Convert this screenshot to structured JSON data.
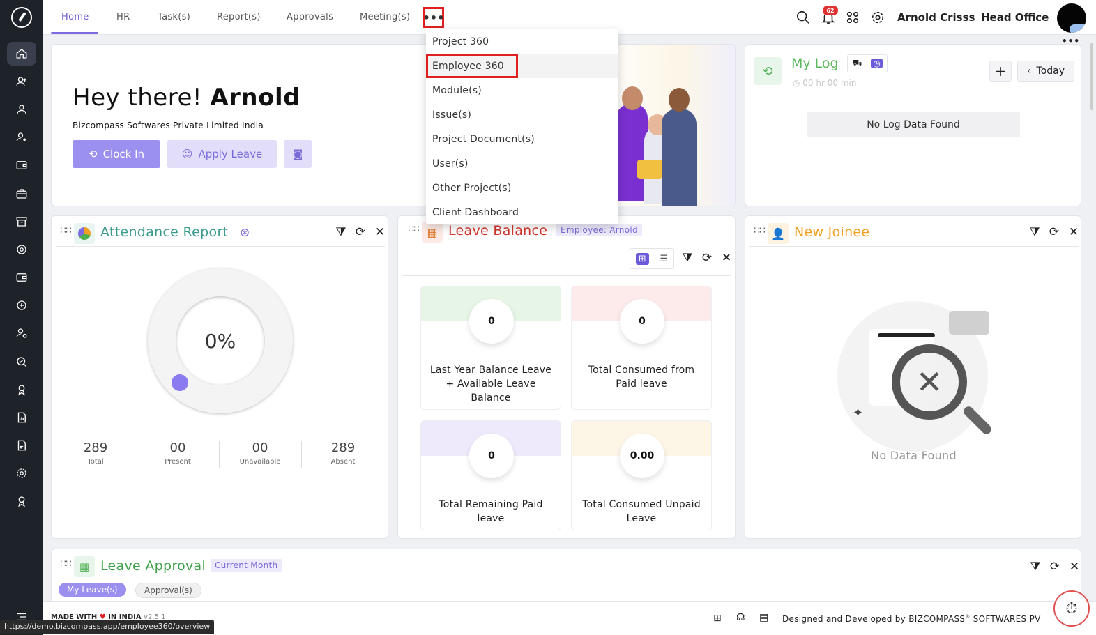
{
  "nav": {
    "tabs": [
      "Home",
      "HR",
      "Task(s)",
      "Report(s)",
      "Approvals",
      "Meeting(s)"
    ],
    "more_label": "•••"
  },
  "dropdown": {
    "items": [
      "Project 360",
      "Employee 360",
      "Module(s)",
      "Issue(s)",
      "Project Document(s)",
      "User(s)",
      "Other Project(s)",
      "Client Dashboard"
    ]
  },
  "header": {
    "notification_count": "62",
    "user_name": "Arnold Crisss",
    "location": "Head Office"
  },
  "welcome": {
    "greeting": "Hey there!",
    "name": "Arnold",
    "company": "Bizcompass Softwares Private Limited India",
    "clock_in_label": "Clock In",
    "apply_leave_label": "Apply Leave"
  },
  "my_log": {
    "title": "My Log",
    "duration": "00 hr 00 min",
    "today_label": "Today",
    "empty_text": "No Log Data Found"
  },
  "attendance": {
    "title": "Attendance Report",
    "percent": "0%",
    "stats": [
      {
        "value": "289",
        "label": "Total"
      },
      {
        "value": "00",
        "label": "Present"
      },
      {
        "value": "00",
        "label": "Unavailable"
      },
      {
        "value": "289",
        "label": "Absent"
      }
    ]
  },
  "leave_balance": {
    "title": "Leave Balance",
    "employee_tag": "Employee: Arnold",
    "cards": [
      {
        "value": "0",
        "label": "Last Year Balance Leave + Available Leave Balance",
        "color": "#e6f5e6"
      },
      {
        "value": "0",
        "label": "Total Consumed from Paid leave",
        "color": "#fdeaea"
      },
      {
        "value": "0",
        "label": "Total Remaining Paid leave",
        "color": "#eeeafc"
      },
      {
        "value": "0.00",
        "label": "Total Consumed Unpaid Leave",
        "color": "#fdf5e6"
      }
    ]
  },
  "new_joinee": {
    "title": "New Joinee",
    "empty_text": "No Data Found"
  },
  "leave_approval": {
    "title": "Leave Approval",
    "period_tag": "Current Month",
    "tabs": [
      "My Leave(s)",
      "Approval(s)"
    ]
  },
  "footer": {
    "made_with": "MADE WITH",
    "in_india": "IN INDIA",
    "version": "v2.5.1",
    "designed_by": "Designed and Developed by",
    "company": "BIZCOMPASS",
    "company_suffix": "SOFTWARES PV"
  },
  "status_bar_url": "https://demo.bizcompass.app/employee360/overview",
  "colors": {
    "accent": "#7b6be0",
    "attendance_title": "#3b9a8e",
    "leave_balance_title": "#d4332a",
    "new_joinee_title": "#f0a020",
    "leave_approval_title": "#3fa04a",
    "my_log_title": "#5cb85c",
    "highlight_red": "#e02020"
  }
}
